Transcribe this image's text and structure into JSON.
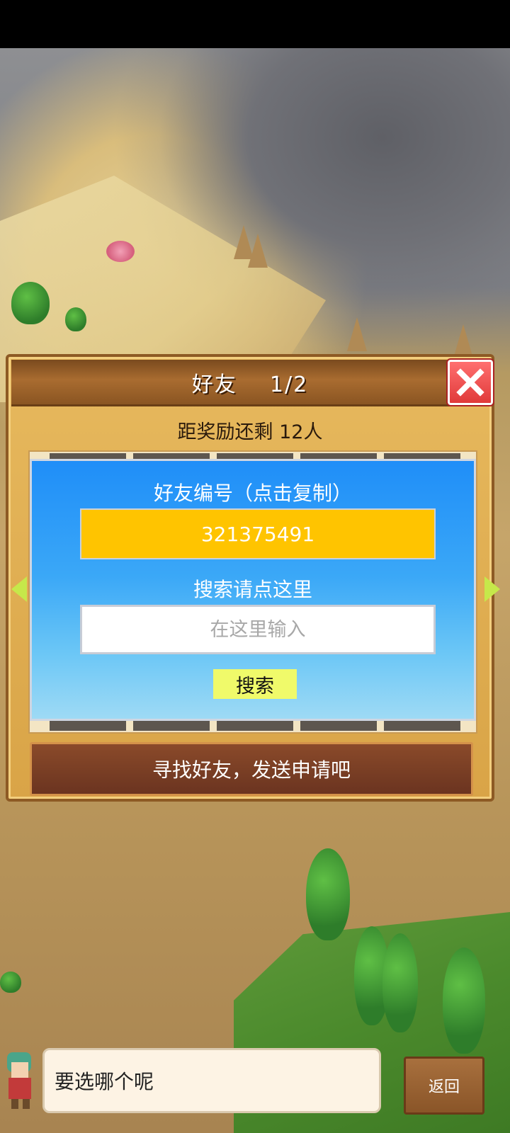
{
  "dialog": {
    "title": "好友    1/2",
    "reward_text": "距奖励还剩 12人",
    "friend_id_label": "好友编号（点击复制）",
    "friend_id_value": "321375491",
    "search_label": "搜索请点这里",
    "search_placeholder": "在这里输入",
    "search_button": "搜索",
    "find_friend_prompt": "寻找好友，发送申请吧"
  },
  "bottom": {
    "speech_text": "要选哪个呢",
    "back_label": "返回"
  },
  "colors": {
    "friend_id_box": "#ffc400",
    "search_button": "#f0fa6a",
    "panel_top": "#1f8ef8",
    "close_red": "#e03a3a"
  },
  "icons": {
    "close": "close-icon",
    "page_left": "arrow-left-icon",
    "page_right": "arrow-right-icon"
  }
}
